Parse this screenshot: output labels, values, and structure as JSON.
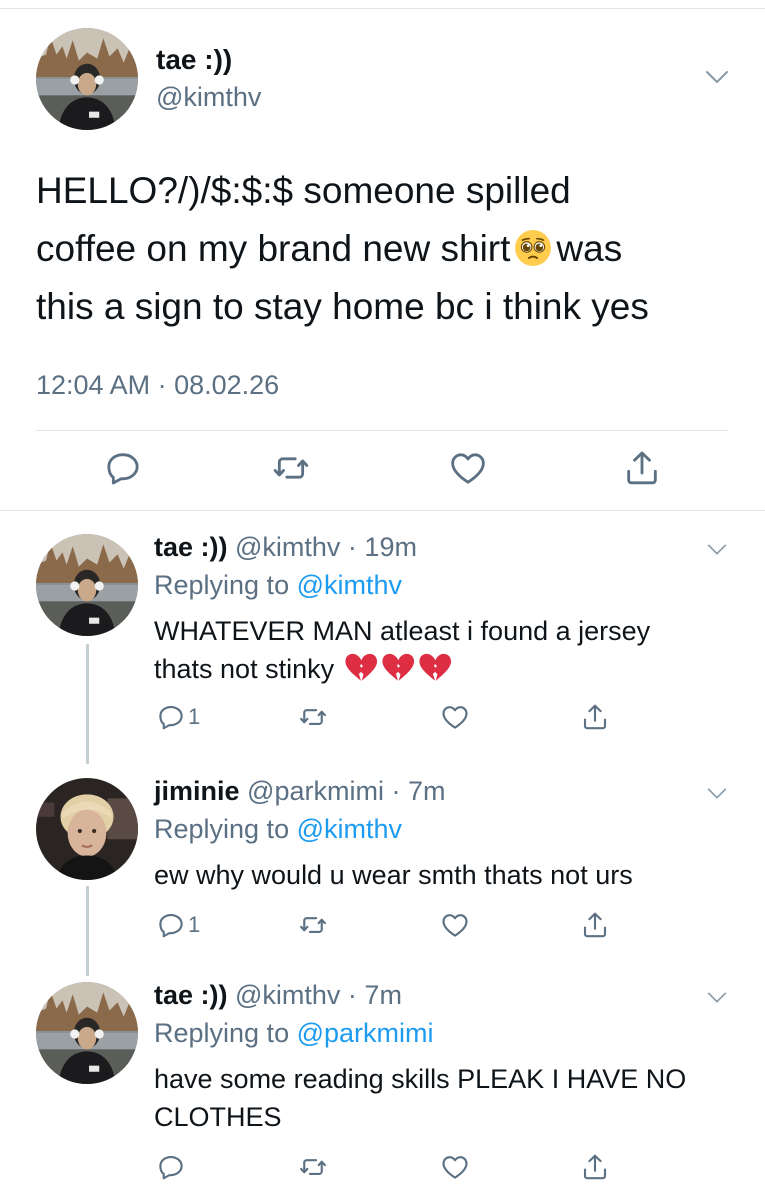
{
  "main_tweet": {
    "name": "tae :))",
    "handle": "@kimthv",
    "text_line1": "HELLO?/)/$:$:$ someone spilled",
    "text_line2a": "coffee on my brand new shirt",
    "text_line2b": "was",
    "text_line3": "this a sign to stay home bc i think yes",
    "timestamp": "12:04 AM · 08.02.26"
  },
  "replies": [
    {
      "name": "tae :))",
      "handle_time": "@kimthv · 19m",
      "replying_prefix": "Replying to",
      "replying_to": "@kimthv",
      "text_line1": "WHATEVER MAN atleast i found a jersey",
      "text_line2": "thats not stinky",
      "reply_count": "1"
    },
    {
      "name": "jiminie",
      "handle_time": "@parkmimi · 7m",
      "replying_prefix": "Replying to",
      "replying_to": "@kimthv",
      "text_line1": "ew why would u wear smth thats not urs",
      "reply_count": "1"
    },
    {
      "name": "tae :))",
      "handle_time": "@kimthv · 7m",
      "replying_prefix": "Replying to",
      "replying_to": "@parkmimi",
      "text_line1": "have some reading skills PLEAK I HAVE NO",
      "text_line2": "CLOTHES",
      "reply_count": ""
    }
  ],
  "icons": {
    "reply": "speech-bubble-icon",
    "retweet": "retweet-icon",
    "like": "heart-icon",
    "share": "share-icon",
    "more": "chevron-down-icon",
    "emoji_pleading": "pleading-face-emoji",
    "emoji_broken_heart": "broken-heart-emoji"
  },
  "colors": {
    "text": "#0f1419",
    "secondary": "#5b7083",
    "link": "#1d9bf0",
    "divider": "#e1e4e8",
    "thread": "#c4cfd6"
  }
}
